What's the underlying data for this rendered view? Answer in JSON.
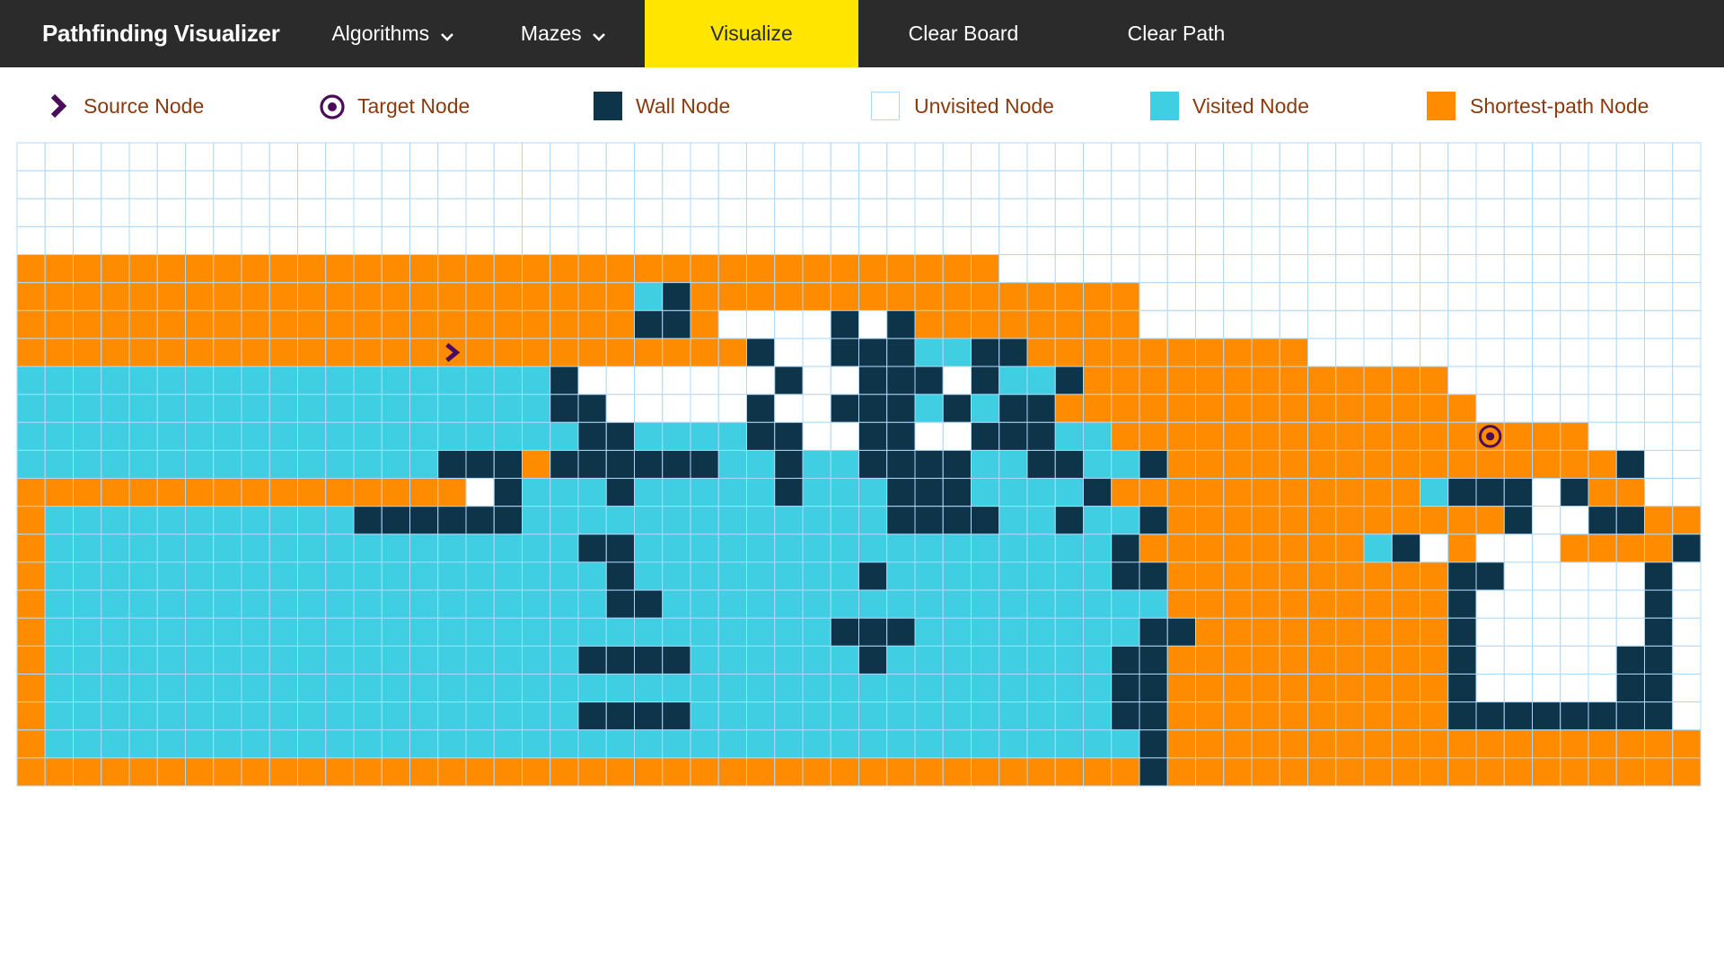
{
  "navbar": {
    "brand": "Pathfinding Visualizer",
    "algorithms_label": "Algorithms",
    "mazes_label": "Mazes",
    "visualize_label": "Visualize",
    "clear_board_label": "Clear Board",
    "clear_path_label": "Clear Path"
  },
  "legend": {
    "source_label": "Source Node",
    "target_label": "Target Node",
    "wall_label": "Wall Node",
    "unvisited_label": "Unvisited Node",
    "visited_label": "Visited Node",
    "shortest_label": "Shortest-path Node"
  },
  "colors": {
    "navbar_bg": "#2b2b2b",
    "visualize_bg": "#ffe500",
    "wall": "#0e3449",
    "visited": "#40cee3",
    "shortest_path": "#ff8c00",
    "unvisited": "#ffffff",
    "grid_line": "#afd8f8",
    "icon": "#4b0d5a"
  },
  "icons": {
    "source": "chevron-right-icon",
    "target": "target-icon",
    "dropdown": "chevron-down-icon"
  },
  "grid": {
    "columns": 60,
    "rows": 23,
    "source": [
      7,
      15
    ],
    "target": [
      10,
      52
    ],
    "cell_legend": {
      "o": "shortest-path",
      "v": "visited",
      "w": "wall",
      ".": "unvisited"
    },
    "cells": [
      "............................................................",
      "............................................................",
      "............................................................",
      "............................................................",
      "ooooooooooooooooooooooooooooooooooo.........................",
      "oooooooooooooooooooooovwoooooooooooooooo....................",
      "oooooooooooooooooooooowwo....w.woooooooo....................",
      "oooooooooooooooooooooooooow..wwwvvwwoooooooooo..............",
      "vvvvvvvvvvvvvvvvvvvw.......w..www.wvvwooooooooooooo.........",
      "vvvvvvvvvvvvvvvvvvvww.....w..wwwvwvwwooooooooooooooo........",
      "vvvvvvvvvvvvvvvvvvvvwwvvvvww..ww..wwwvvooooooooooooooooo....",
      "vvvvvvvvvvvvvvvwwwowwwwwwvvwvvwwwwvvwwvvwoooooooooooooooow..",
      "oooooooooooooooo.wvvvwvvvvvwvvvwwwvvvvwooooooooooovwww.woo..",
      "ovvvvvvvvvvvwwwwwwvvvvvvvvvvvvvwwwwvvwvvwoooooooooooow..wwoo.",
      "ovvvvvvvvvvvvvvvvvvvwwvvvvvvvvvvvvvvvvvwoooooooovw.o...oooow.",
      "ovvvvvvvvvvvvvvvvvvvvwvvvvvvvvwvvvvvvvvwwooooooooooww.....w.",
      "ovvvvvvvvvvvvvvvvvvvvwwvvvvvvvvvvvvvvvvvvoooooooooow......w.",
      "ovvvvvvvvvvvvvvvvvvvvvvvvvvvvwwwvvvvvvvvwwooooooooow......w.",
      "ovvvvvvvvvvvvvvvvvvvwwwwvvvvvvwvvvvvvvvwwoooooooooow.....ww.",
      "ovvvvvvvvvvvvvvvvvvvvvvvvvvvvvvvvvvvvvvwwoooooooooow.....ww.",
      "ovvvvvvvvvvvvvvvvvvvwwwwvvvvvvvvvvvvvvvwwoooooooooowwwwwwww.",
      "ovvvvvvvvvvvvvvvvvvvvvvvvvvvvvvvvvvvvvvvwoooooooooooooooooooo",
      "oooooooooooooooooooooooooooooooooooooooowoooooooooooooooooooo"
    ]
  }
}
